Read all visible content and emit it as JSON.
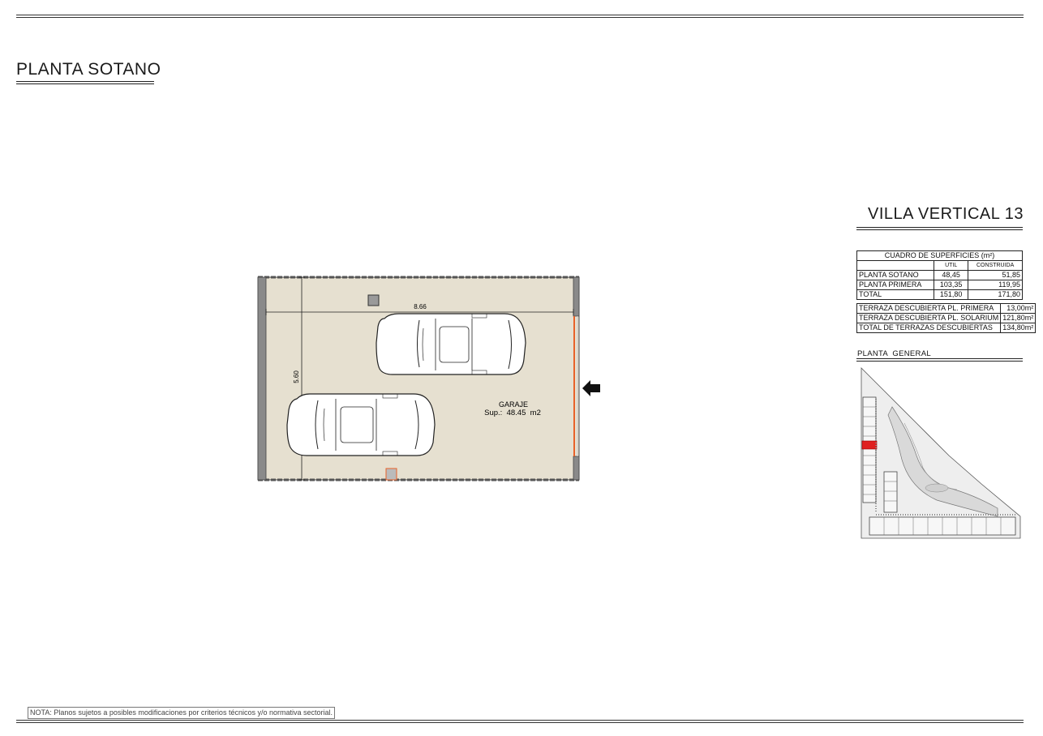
{
  "plan_title": "PLANTA SOTANO",
  "villa_title": "VILLA VERTICAL 13",
  "room": {
    "name": "GARAJE",
    "surface": "Sup.:  48.45  m2"
  },
  "dimensions": {
    "width": "8.66",
    "depth": "5.60"
  },
  "surfaces_table": {
    "title": "CUADRO DE SUPERFICIES (m²)",
    "headers": [
      "UTIL",
      "CONSTRUIDA"
    ],
    "rows": [
      {
        "label": "PLANTA SOTANO",
        "util": "48,45",
        "construida": "51,85"
      },
      {
        "label": "PLANTA PRIMERA",
        "util": "103,35",
        "construida": "119,95"
      },
      {
        "label": "TOTAL",
        "util": "151,80",
        "construida": "171,80"
      }
    ]
  },
  "terraces_table": {
    "rows": [
      {
        "label": "TERRAZA DESCUBIERTA PL. PRIMERA",
        "value": "13,00m²"
      },
      {
        "label": "TERRAZA DESCUBIERTA PL. SOLARIUM",
        "value": "121,80m²"
      },
      {
        "label": "TOTAL DE TERRAZAS DESCUBIERTAS",
        "value": "134,80m²"
      }
    ]
  },
  "site_plan": {
    "label": "PLANTA  GENERAL",
    "highlight_color": "#e02020"
  },
  "note": "NOTA: Planos sujetos a posibles modificaciones por criterios técnicos y/o normativa sectorial.",
  "colors": {
    "floor_fill": "#e6e0d0",
    "wall": "#888888",
    "door_accent": "#e8622a"
  }
}
